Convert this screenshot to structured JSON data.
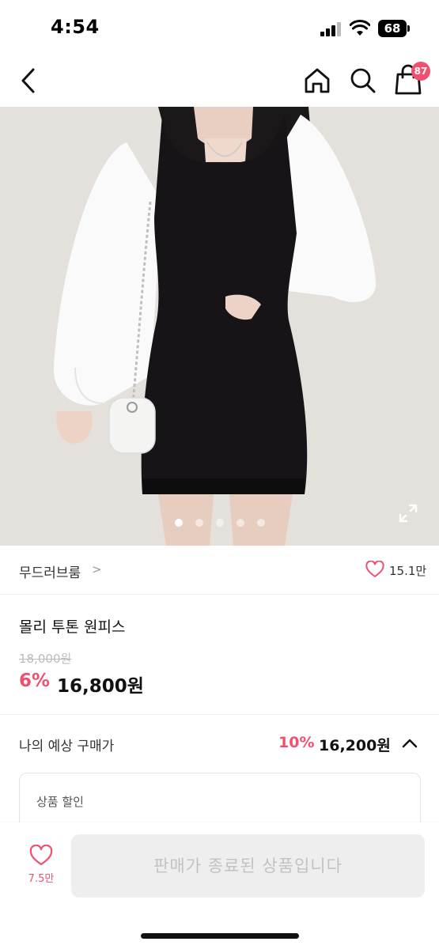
{
  "status_bar": {
    "time": "4:54",
    "battery": "68"
  },
  "nav": {
    "cart_count": "87"
  },
  "carousel": {
    "total_slides": 5,
    "active_slide": 1
  },
  "brand": {
    "name": "무드러브룸",
    "chevron": ">",
    "likes": "15.1만"
  },
  "product": {
    "title": "몰리 투톤 원피스",
    "original_price": "18,000원",
    "discount_rate": "6%",
    "sale_price": "16,800원"
  },
  "expected_price": {
    "label": "나의 예상 구매가",
    "discount_rate": "10%",
    "price": "16,200원"
  },
  "discount_detail": {
    "label": "상품 할인"
  },
  "bottom_bar": {
    "like_count": "7.5만",
    "status_button": "판매가 종료된 상품입니다"
  },
  "colors": {
    "accent": "#f0506e",
    "disabled_bg": "#eeeeee",
    "disabled_text": "#c2c2c2"
  },
  "icons": [
    "back-icon",
    "home-icon",
    "search-icon",
    "shopping-bag-icon",
    "expand-icon",
    "heart-icon",
    "chevron-up-icon"
  ]
}
